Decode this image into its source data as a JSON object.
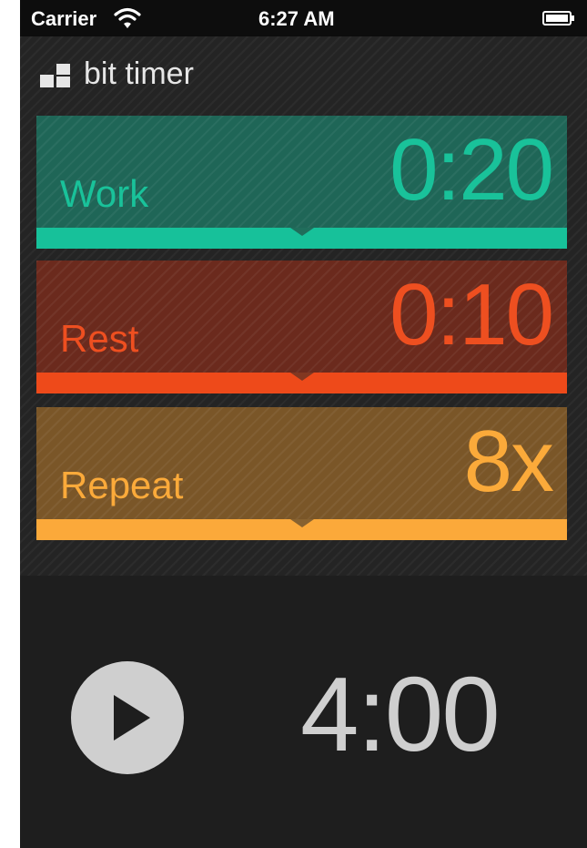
{
  "status_bar": {
    "carrier": "Carrier",
    "time": "6:27 AM",
    "icons": [
      "wifi-icon",
      "battery-icon"
    ]
  },
  "app": {
    "name": "bit timer",
    "logo_icon": "blocks-logo-icon"
  },
  "intervals": [
    {
      "label": "Work",
      "value": "0:20",
      "color": "#19c29a",
      "background": "#1f6657"
    },
    {
      "label": "Rest",
      "value": "0:10",
      "color": "#ee4f20",
      "background": "#6b2a1d"
    },
    {
      "label": "Repeat",
      "value": "8x",
      "color": "#fbaa3a",
      "background": "#7a5628"
    }
  ],
  "controls": {
    "play_icon": "play-icon",
    "total_time": "4:00"
  }
}
